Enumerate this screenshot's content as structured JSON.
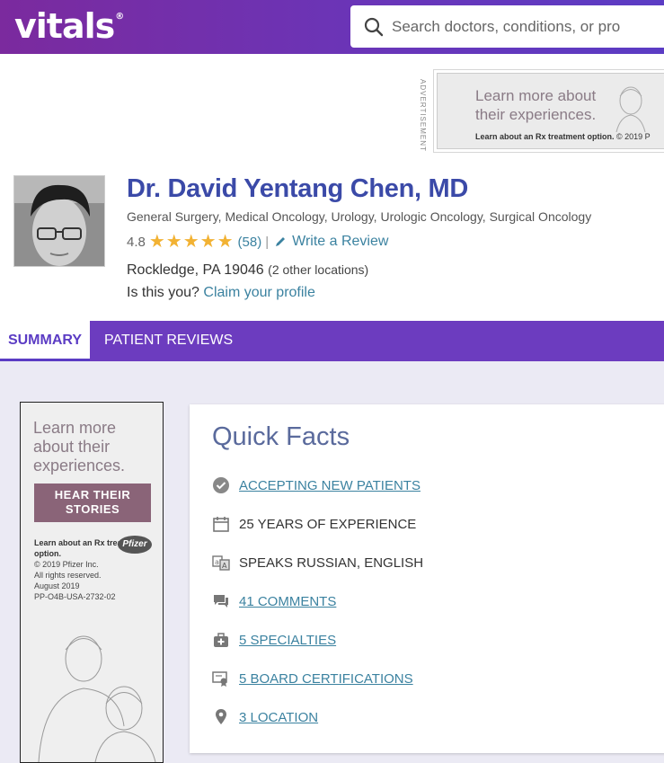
{
  "header": {
    "logo": "vitals",
    "logo_mark": "®",
    "search_placeholder": "Search doctors, conditions, or pro"
  },
  "top_ad": {
    "label": "ADVERTISEMENT",
    "headline": "Learn more about their experiences.",
    "fine_bold": "Learn about an Rx treatment option.",
    "fine_rest": " © 2019 P"
  },
  "profile": {
    "name": "Dr. David Yentang Chen, MD",
    "specialties": "General Surgery, Medical Oncology, Urology, Urologic Oncology, Surgical Oncology",
    "rating": "4.8",
    "rating_value": 4.8,
    "stars_max": 5,
    "review_count": "(58)",
    "separator": "|",
    "write_review": "Write a Review",
    "location": "Rockledge, PA 19046",
    "other_locations": "(2 other locations)",
    "claim_prompt": "Is this you?",
    "claim_link": "Claim your profile"
  },
  "tabs": {
    "summary": "SUMMARY",
    "patient_reviews": "PATIENT REVIEWS"
  },
  "side_ad": {
    "headline": "Learn more about their experiences.",
    "button": "HEAR THEIR STORIES",
    "fine_bold": "Learn about an Rx treatment option.",
    "fine_lines": [
      "© 2019 Pfizer Inc.",
      "All rights reserved.",
      "August 2019",
      "PP-O4B-USA-2732-02"
    ],
    "brand": "Pfizer"
  },
  "quick_facts": {
    "title": "Quick Facts",
    "items": [
      {
        "text": "ACCEPTING NEW PATIENTS",
        "icon": "check-circle-icon",
        "link": true
      },
      {
        "text": "25 YEARS OF EXPERIENCE",
        "icon": "calendar-icon",
        "link": false
      },
      {
        "text": "SPEAKS RUSSIAN, ENGLISH",
        "icon": "translate-icon",
        "link": false
      },
      {
        "text": "41 COMMENTS",
        "icon": "comments-icon",
        "link": true
      },
      {
        "text": "5 SPECIALTIES",
        "icon": "medical-bag-icon",
        "link": true
      },
      {
        "text": "5 BOARD CERTIFICATIONS",
        "icon": "certificate-icon",
        "link": true
      },
      {
        "text": "3 LOCATION",
        "icon": "map-pin-icon",
        "link": true
      }
    ]
  },
  "colors": {
    "header_start": "#7b2a9e",
    "header_end": "#5b3cc4",
    "name": "#3b4aa8",
    "link": "#3b82a0",
    "star": "#f2b233",
    "tab_bar": "#6c3cbf"
  }
}
